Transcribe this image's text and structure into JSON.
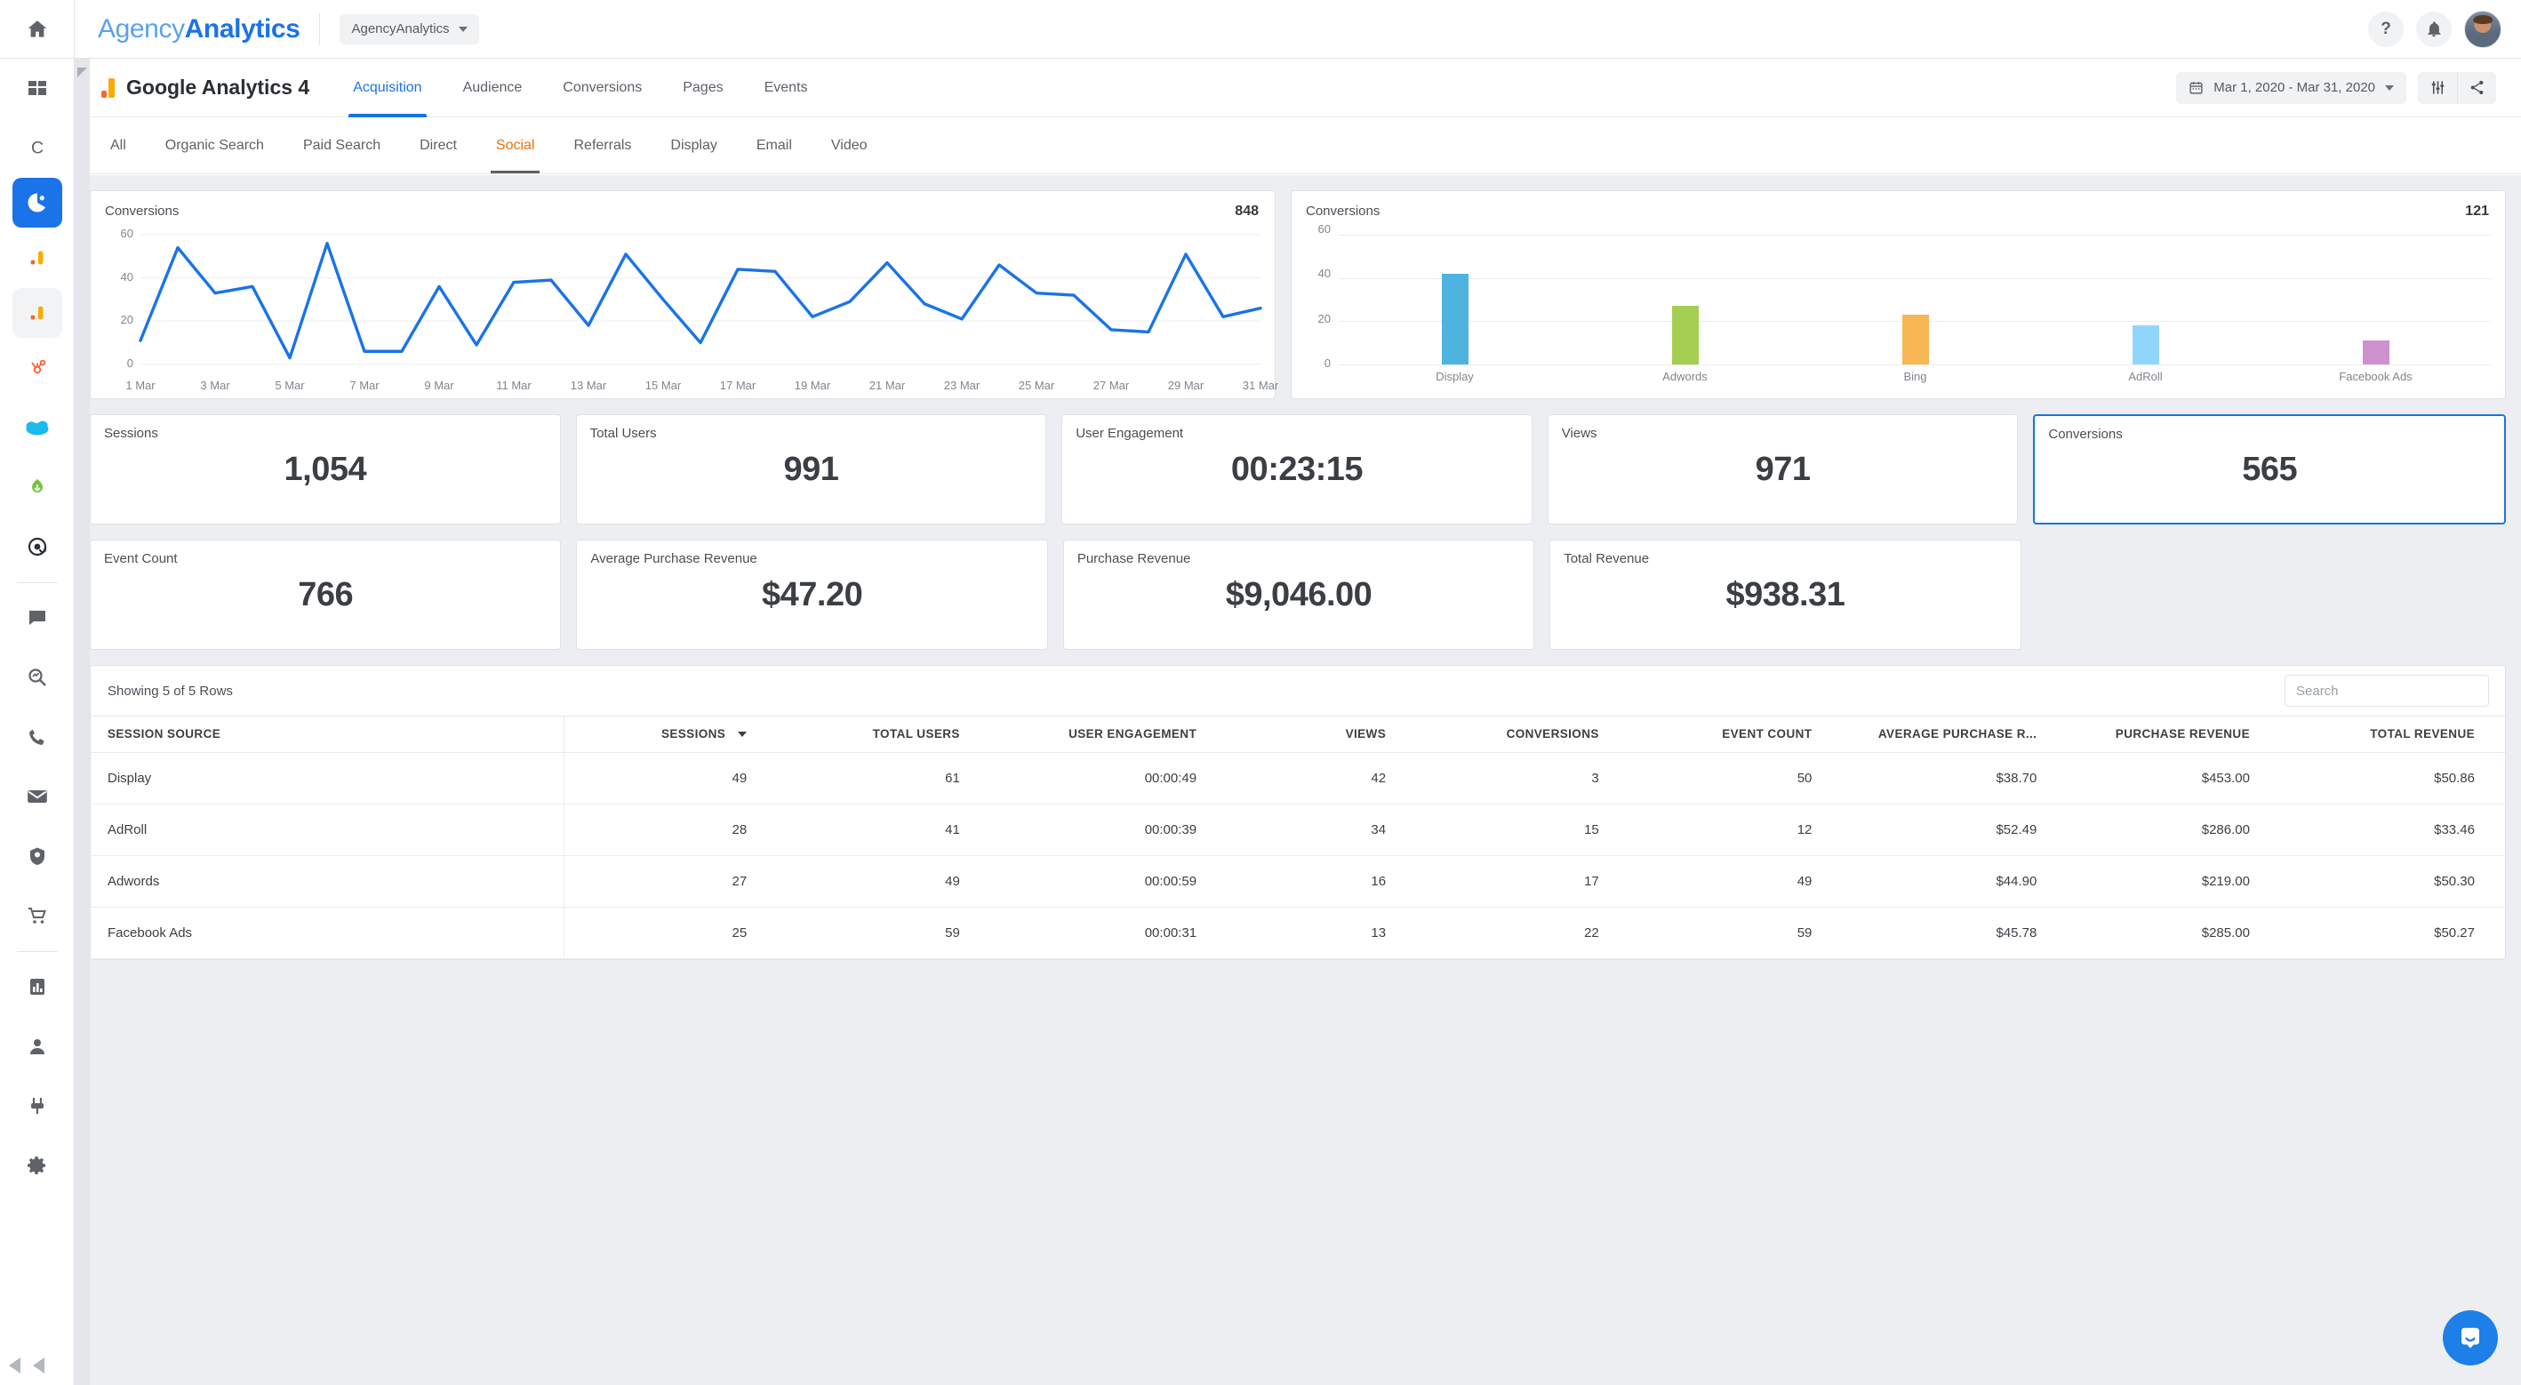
{
  "brand": {
    "light": "Agency",
    "bold": "Analytics"
  },
  "account_picker": {
    "label": "AgencyAnalytics"
  },
  "topbar": {
    "help_icon": "question-mark-icon",
    "notifications_icon": "bell-icon",
    "avatar": "user-avatar"
  },
  "report": {
    "title": "Google Analytics 4",
    "tabs": [
      {
        "label": "Acquisition",
        "active": true
      },
      {
        "label": "Audience",
        "active": false
      },
      {
        "label": "Conversions",
        "active": false
      },
      {
        "label": "Pages",
        "active": false
      },
      {
        "label": "Events",
        "active": false
      }
    ],
    "date_range": "Mar 1, 2020 - Mar 31, 2020",
    "calendar_icon": "calendar-icon",
    "settings_icon": "sliders-icon",
    "share_icon": "share-icon"
  },
  "filters": {
    "tabs": [
      {
        "label": "All",
        "active": false
      },
      {
        "label": "Organic Search",
        "active": false
      },
      {
        "label": "Paid Search",
        "active": false
      },
      {
        "label": "Direct",
        "active": false
      },
      {
        "label": "Social",
        "active": true
      },
      {
        "label": "Referrals",
        "active": false
      },
      {
        "label": "Display",
        "active": false
      },
      {
        "label": "Email",
        "active": false
      },
      {
        "label": "Video",
        "active": false
      }
    ]
  },
  "chart_data": [
    {
      "type": "line",
      "title": "Conversions",
      "total": "848",
      "xlabel": "",
      "ylabel": "",
      "ylim": [
        0,
        60
      ],
      "yticks": [
        0,
        20,
        40,
        60
      ],
      "grid": true,
      "legend": "none",
      "line_color": "#1a73e8",
      "categories": [
        "1 Mar",
        "2 Mar",
        "3 Mar",
        "4 Mar",
        "5 Mar",
        "6 Mar",
        "7 Mar",
        "8 Mar",
        "9 Mar",
        "10 Mar",
        "11 Mar",
        "12 Mar",
        "13 Mar",
        "14 Mar",
        "15 Mar",
        "16 Mar",
        "17 Mar",
        "18 Mar",
        "19 Mar",
        "20 Mar",
        "21 Mar",
        "22 Mar",
        "23 Mar",
        "24 Mar",
        "25 Mar",
        "26 Mar",
        "27 Mar",
        "28 Mar",
        "29 Mar",
        "30 Mar",
        "31 Mar"
      ],
      "xtick_labels": [
        "1 Mar",
        "3 Mar",
        "5 Mar",
        "7 Mar",
        "9 Mar",
        "11 Mar",
        "13 Mar",
        "15 Mar",
        "17 Mar",
        "19 Mar",
        "21 Mar",
        "23 Mar",
        "25 Mar",
        "27 Mar",
        "29 Mar",
        "31 Mar"
      ],
      "values": [
        11,
        54,
        33,
        36,
        3,
        56,
        6,
        6,
        36,
        9,
        38,
        39,
        18,
        51,
        30,
        10,
        44,
        43,
        22,
        29,
        47,
        28,
        21,
        46,
        33,
        32,
        16,
        15,
        51,
        22,
        26
      ]
    },
    {
      "type": "bar",
      "title": "Conversions",
      "total": "121",
      "xlabel": "",
      "ylabel": "",
      "ylim": [
        0,
        60
      ],
      "yticks": [
        0,
        20,
        40,
        60
      ],
      "grid": true,
      "legend": "none",
      "categories": [
        "Display",
        "Adwords",
        "Bing",
        "AdRoll",
        "Facebook Ads"
      ],
      "values": [
        42,
        27,
        23,
        18,
        11
      ],
      "colors": [
        "#4fb3e0",
        "#a4cf52",
        "#f7b košt"
      ]
    }
  ],
  "bar_colors": [
    "#4fb3e0",
    "#a4cf52",
    "#f7b754",
    "#90d6fb",
    "#cf90ce"
  ],
  "kpi_row1": [
    {
      "label": "Sessions",
      "value": "1,054",
      "highlight": false
    },
    {
      "label": "Total Users",
      "value": "991",
      "highlight": false
    },
    {
      "label": "User Engagement",
      "value": "00:23:15",
      "highlight": false
    },
    {
      "label": "Views",
      "value": "971",
      "highlight": false
    },
    {
      "label": "Conversions",
      "value": "565",
      "highlight": true
    }
  ],
  "kpi_row2": [
    {
      "label": "Event Count",
      "value": "766"
    },
    {
      "label": "Average Purchase Revenue",
      "value": "$47.20"
    },
    {
      "label": "Purchase Revenue",
      "value": "$9,046.00"
    },
    {
      "label": "Total Revenue",
      "value": "$938.31"
    }
  ],
  "table": {
    "showing": "Showing 5 of 5 Rows",
    "search_placeholder": "Search",
    "sorted_column": "SESSIONS",
    "columns": [
      "SESSION SOURCE",
      "SESSIONS",
      "TOTAL USERS",
      "USER ENGAGEMENT",
      "VIEWS",
      "CONVERSIONS",
      "EVENT COUNT",
      "AVERAGE PURCHASE R...",
      "PURCHASE REVENUE",
      "TOTAL REVENUE"
    ],
    "rows": [
      [
        "Display",
        "49",
        "61",
        "00:00:49",
        "42",
        "3",
        "50",
        "$38.70",
        "$453.00",
        "$50.86"
      ],
      [
        "AdRoll",
        "28",
        "41",
        "00:00:39",
        "34",
        "15",
        "12",
        "$52.49",
        "$286.00",
        "$33.46"
      ],
      [
        "Adwords",
        "27",
        "49",
        "00:00:59",
        "16",
        "17",
        "49",
        "$44.90",
        "$219.00",
        "$50.30"
      ],
      [
        "Facebook Ads",
        "25",
        "59",
        "00:00:31",
        "13",
        "22",
        "59",
        "$45.78",
        "$285.00",
        "$50.27"
      ]
    ]
  },
  "chat": {
    "icon": "intercom-chat-icon",
    "color": "#1d7fe8"
  }
}
